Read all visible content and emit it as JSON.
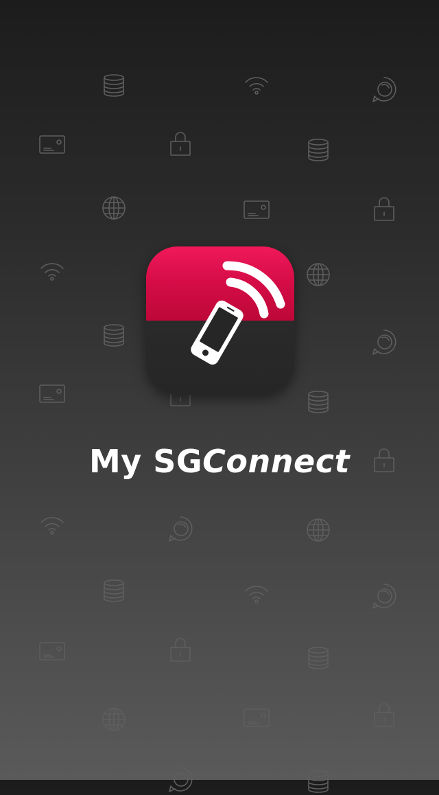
{
  "splash": {
    "app_name_part1": "My SG",
    "app_name_part2": "Connect",
    "brand_color_top": "#d40c46",
    "brand_color_bottom": "#262626",
    "icon_name": "phone-signal-icon"
  },
  "background_icons": [
    "coins-icon",
    "wifi-icon",
    "chat-bubble-icon",
    "card-icon",
    "lock-icon",
    "globe-icon"
  ]
}
